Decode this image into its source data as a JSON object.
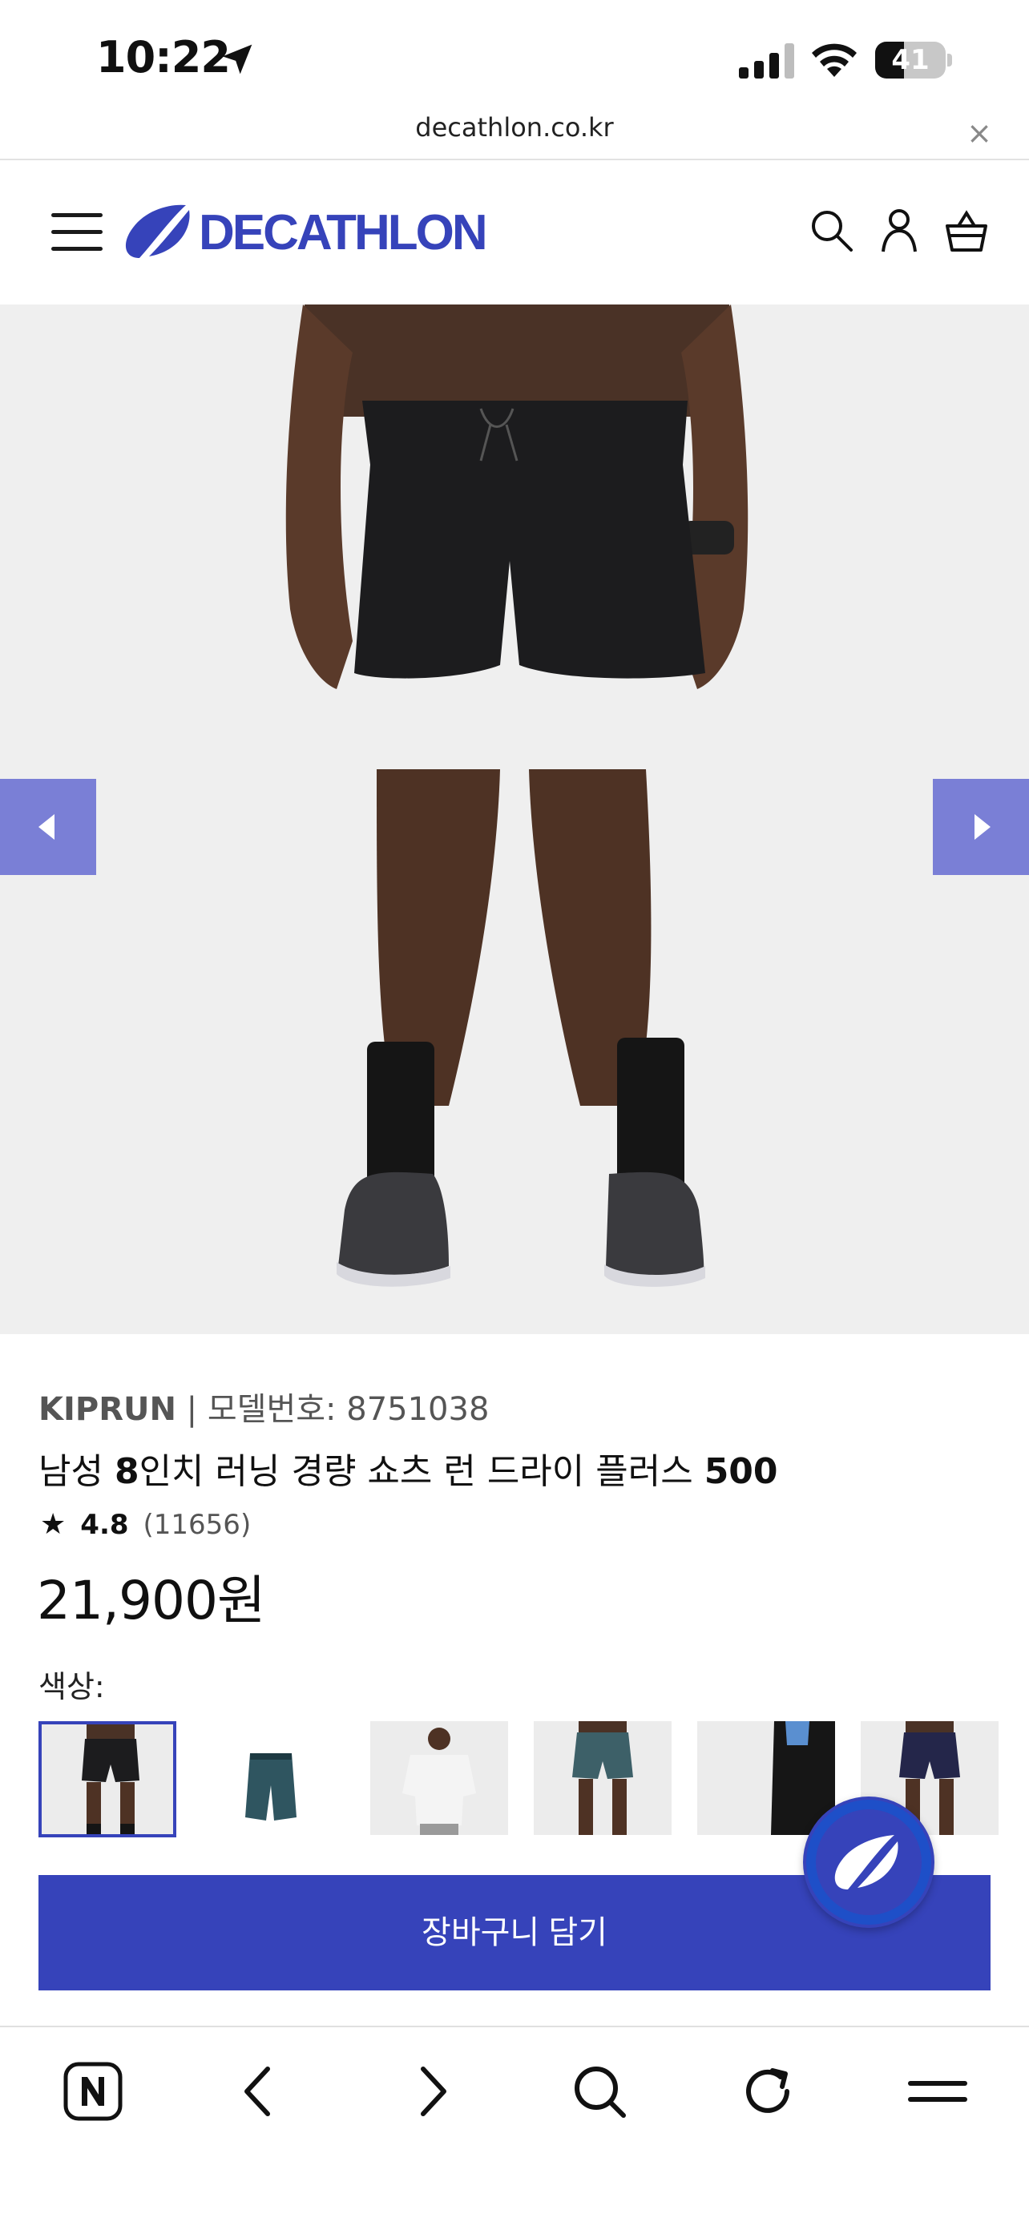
{
  "status_bar": {
    "time": "10:22",
    "battery": "41",
    "battery_level": 0.41
  },
  "browser": {
    "url": "decathlon.co.kr",
    "close_symbol": "×"
  },
  "header": {
    "logo_text": "DECATHLON",
    "brand_color": "#3643ba"
  },
  "product": {
    "brand": "KIPRUN",
    "separator": " | ",
    "model_label": "모델번호: 8751038",
    "title_parts": [
      {
        "text": "남성 ",
        "bold": false
      },
      {
        "text": "8",
        "bold": true
      },
      {
        "text": "인치 러닝 경량 쇼츠 런 드라이 플러스 ",
        "bold": false
      },
      {
        "text": "500",
        "bold": true
      }
    ],
    "rating_star": "★",
    "rating_score": "4.8",
    "rating_count": "(11656)",
    "price": "21,900원",
    "color_label": "색상:",
    "add_to_cart": "장바구니 담기"
  },
  "swatches": [
    {
      "name": "black-shorts-model",
      "selected": true
    },
    {
      "name": "teal-shorts-flat",
      "selected": false
    },
    {
      "name": "white-tee-model",
      "selected": false
    },
    {
      "name": "teal-shorts-model",
      "selected": false
    },
    {
      "name": "black-shorts-pocket-detail",
      "selected": false
    },
    {
      "name": "navy-shorts-model",
      "selected": false
    }
  ],
  "toolbar": {
    "icons": [
      "naver-n-icon",
      "back-icon",
      "forward-icon",
      "search-icon",
      "reload-icon",
      "menu-icon"
    ]
  }
}
